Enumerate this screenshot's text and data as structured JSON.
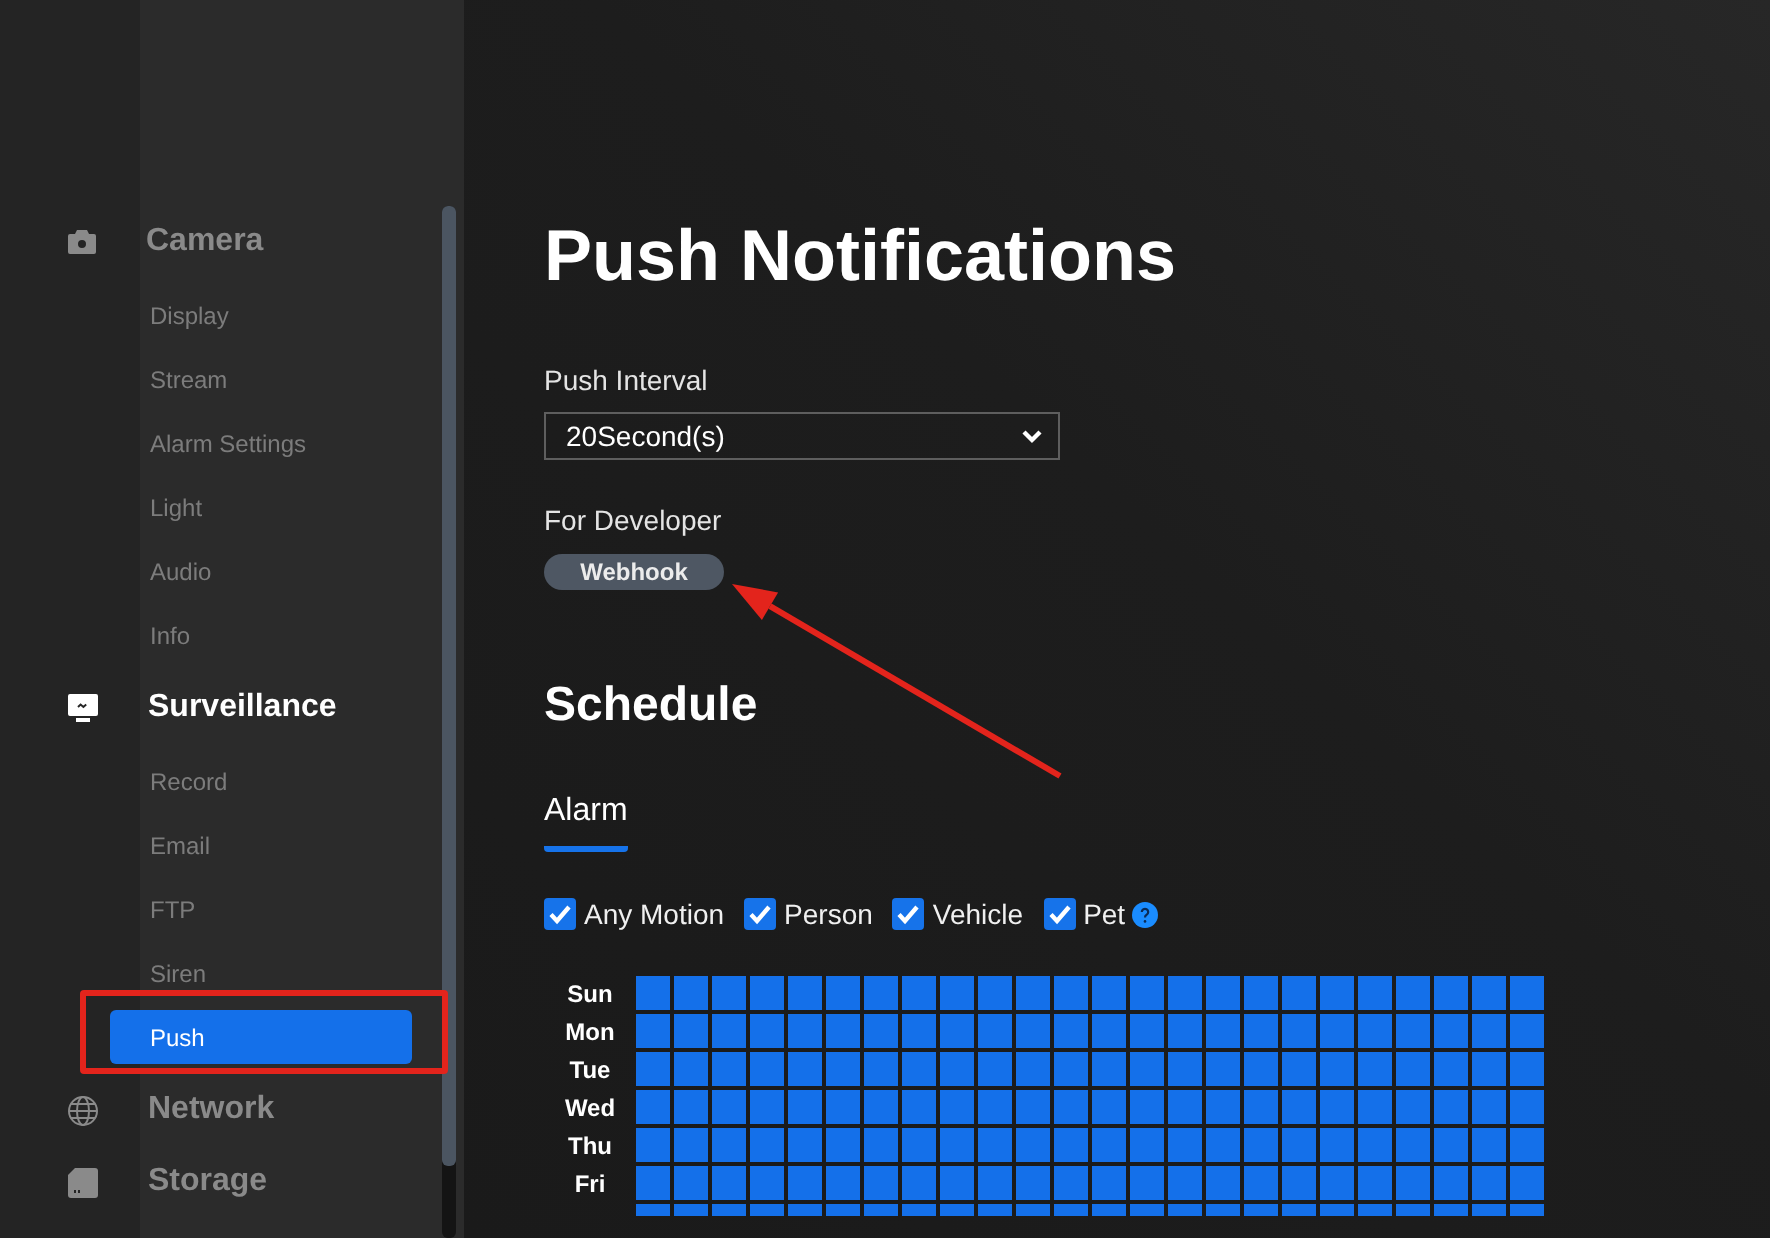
{
  "sidebar": {
    "groups": [
      {
        "label": "Camera",
        "selected": false,
        "items": [
          {
            "label": "Display",
            "selected": false,
            "highlighted": false
          },
          {
            "label": "Stream",
            "selected": false,
            "highlighted": false
          },
          {
            "label": "Alarm Settings",
            "selected": false,
            "highlighted": false
          },
          {
            "label": "Light",
            "selected": false,
            "highlighted": false
          },
          {
            "label": "Audio",
            "selected": false,
            "highlighted": false
          },
          {
            "label": "Info",
            "selected": false,
            "highlighted": false
          }
        ]
      },
      {
        "label": "Surveillance",
        "selected": true,
        "items": [
          {
            "label": "Record",
            "selected": false,
            "highlighted": false
          },
          {
            "label": "Email",
            "selected": false,
            "highlighted": false
          },
          {
            "label": "FTP",
            "selected": false,
            "highlighted": false
          },
          {
            "label": "Siren",
            "selected": false,
            "highlighted": false
          },
          {
            "label": "Push",
            "selected": true,
            "highlighted": true
          }
        ]
      },
      {
        "label": "Network",
        "selected": false
      },
      {
        "label": "Storage",
        "selected": false
      }
    ]
  },
  "page": {
    "title": "Push Notifications",
    "push_interval": {
      "label": "Push Interval",
      "value": "20Second(s)"
    },
    "developer": {
      "label": "For Developer",
      "buttons": [
        {
          "label": "Webhook",
          "pointed_at": true
        }
      ]
    }
  },
  "schedule": {
    "title": "Schedule",
    "tabs": [
      {
        "label": "Alarm",
        "selected": true
      }
    ],
    "filters": [
      {
        "label": "Any Motion",
        "checked": true,
        "help": false
      },
      {
        "label": "Person",
        "checked": true,
        "help": false
      },
      {
        "label": "Vehicle",
        "checked": true,
        "help": false
      },
      {
        "label": "Pet",
        "checked": true,
        "help": true
      }
    ],
    "rows": [
      {
        "day": "Sun",
        "slots": [
          true,
          true,
          true,
          true,
          true,
          true,
          true,
          true,
          true,
          true,
          true,
          true,
          true,
          true,
          true,
          true,
          true,
          true,
          true,
          true,
          true,
          true,
          true,
          true
        ]
      },
      {
        "day": "Mon",
        "slots": [
          true,
          true,
          true,
          true,
          true,
          true,
          true,
          true,
          true,
          true,
          true,
          true,
          true,
          true,
          true,
          true,
          true,
          true,
          true,
          true,
          true,
          true,
          true,
          true
        ]
      },
      {
        "day": "Tue",
        "slots": [
          true,
          true,
          true,
          true,
          true,
          true,
          true,
          true,
          true,
          true,
          true,
          true,
          true,
          true,
          true,
          true,
          true,
          true,
          true,
          true,
          true,
          true,
          true,
          true
        ]
      },
      {
        "day": "Wed",
        "slots": [
          true,
          true,
          true,
          true,
          true,
          true,
          true,
          true,
          true,
          true,
          true,
          true,
          true,
          true,
          true,
          true,
          true,
          true,
          true,
          true,
          true,
          true,
          true,
          true
        ]
      },
      {
        "day": "Thu",
        "slots": [
          true,
          true,
          true,
          true,
          true,
          true,
          true,
          true,
          true,
          true,
          true,
          true,
          true,
          true,
          true,
          true,
          true,
          true,
          true,
          true,
          true,
          true,
          true,
          true
        ]
      },
      {
        "day": "Fri",
        "slots": [
          true,
          true,
          true,
          true,
          true,
          true,
          true,
          true,
          true,
          true,
          true,
          true,
          true,
          true,
          true,
          true,
          true,
          true,
          true,
          true,
          true,
          true,
          true,
          true
        ]
      },
      {
        "slots": [
          true,
          true,
          true,
          true,
          true,
          true,
          true,
          true,
          true,
          true,
          true,
          true,
          true,
          true,
          true,
          true,
          true,
          true,
          true,
          true,
          true,
          true,
          true,
          true
        ]
      }
    ]
  }
}
